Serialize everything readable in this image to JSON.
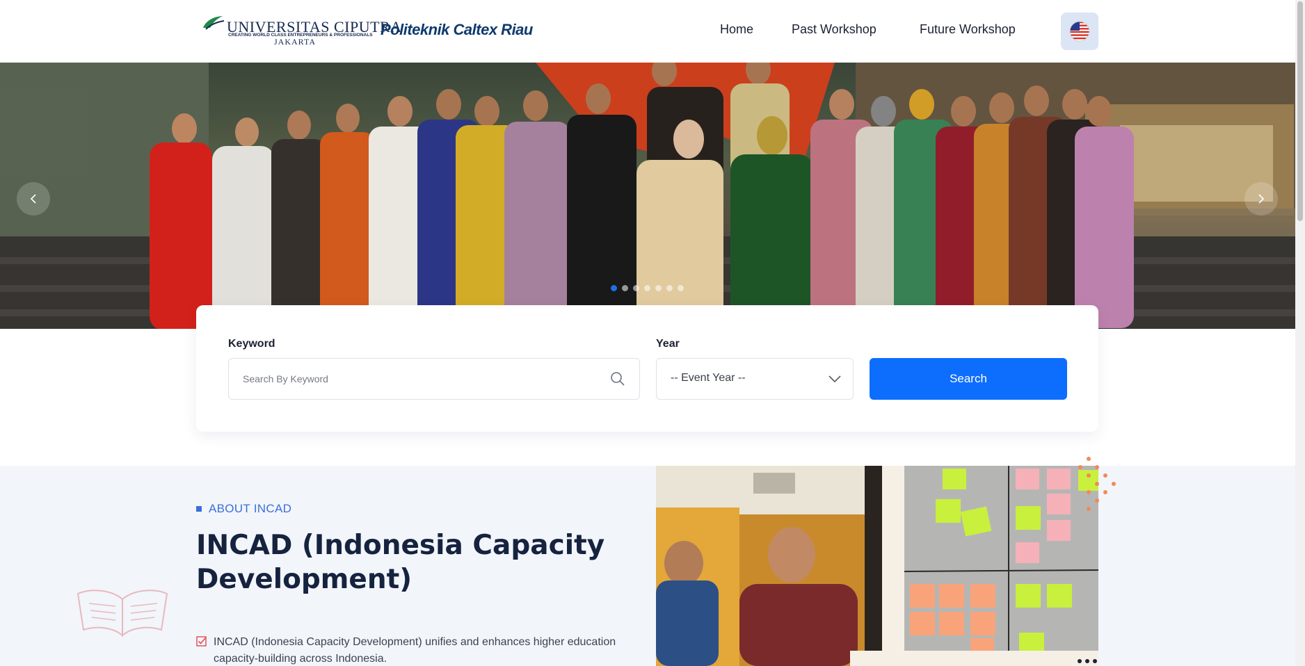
{
  "header": {
    "logo_universitas": {
      "name": "UNIVERSITAS CIPUTRA",
      "tagline": "CREATING WORLD CLASS ENTREPRENEURS & PROFESSIONALS",
      "city": "JAKARTA"
    },
    "logo_politeknik": "Politeknik Caltex Riau",
    "nav": {
      "home": "Home",
      "past_workshop": "Past Workshop",
      "future_workshop": "Future Workshop"
    },
    "language_icon": "us-flag-icon"
  },
  "hero": {
    "slide_count": 7,
    "active_slide": 1,
    "prev_icon": "chevron-left-icon",
    "next_icon": "chevron-right-icon"
  },
  "search": {
    "keyword_label": "Keyword",
    "keyword_placeholder": "Search By Keyword",
    "keyword_value": "",
    "year_label": "Year",
    "year_selected": "-- Event Year --",
    "button_label": "Search"
  },
  "about": {
    "eyebrow": "ABOUT INCAD",
    "title": "INCAD (Indonesia Capacity Development)",
    "bullets": [
      "INCAD (Indonesia Capacity Development) unifies and enhances higher education capacity-building across Indonesia."
    ]
  },
  "colors": {
    "primary": "#0d6efd",
    "accent": "#3a6fd8",
    "heading": "#16233f",
    "section_bg": "#f2f5fa",
    "check": "#e5484d"
  }
}
